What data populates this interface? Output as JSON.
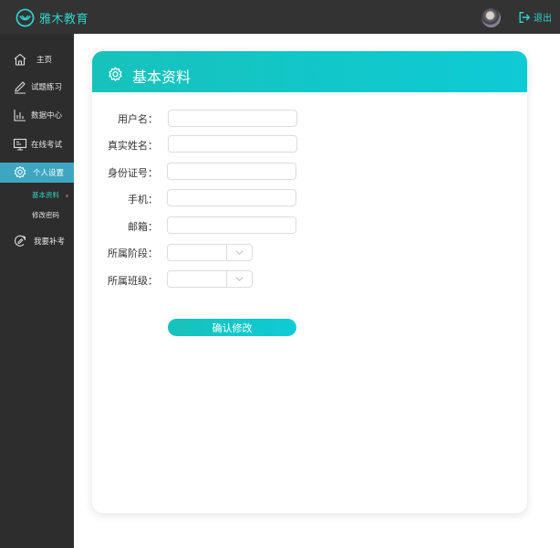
{
  "header": {
    "brand_name": "雅木教育",
    "logout_label": "退出",
    "accent_color": "#2fd3c9"
  },
  "sidebar": {
    "items": [
      {
        "label": "主页",
        "icon": "home-icon"
      },
      {
        "label": "试题练习",
        "icon": "pencil-icon"
      },
      {
        "label": "数据中心",
        "icon": "bar-chart-icon"
      },
      {
        "label": "在线考试",
        "icon": "monitor-icon"
      },
      {
        "label": "个人设置",
        "icon": "gear-icon",
        "active": true
      },
      {
        "label": "我要补考",
        "icon": "refresh-pencil-icon"
      }
    ],
    "sub_items": [
      {
        "label": "基本资料",
        "current": true
      },
      {
        "label": "修改密码"
      }
    ]
  },
  "card": {
    "title": "基本资料",
    "icon": "gear-icon",
    "fields": {
      "username": {
        "label": "用户名：",
        "value": ""
      },
      "realname": {
        "label": "真实姓名：",
        "value": ""
      },
      "idnumber": {
        "label": "身份证号：",
        "value": ""
      },
      "phone": {
        "label": "手机：",
        "value": ""
      },
      "email": {
        "label": "邮箱：",
        "value": ""
      },
      "stage": {
        "label": "所属阶段：",
        "value": ""
      },
      "class": {
        "label": "所属班级：",
        "value": ""
      }
    },
    "submit_label": "确认修改"
  }
}
